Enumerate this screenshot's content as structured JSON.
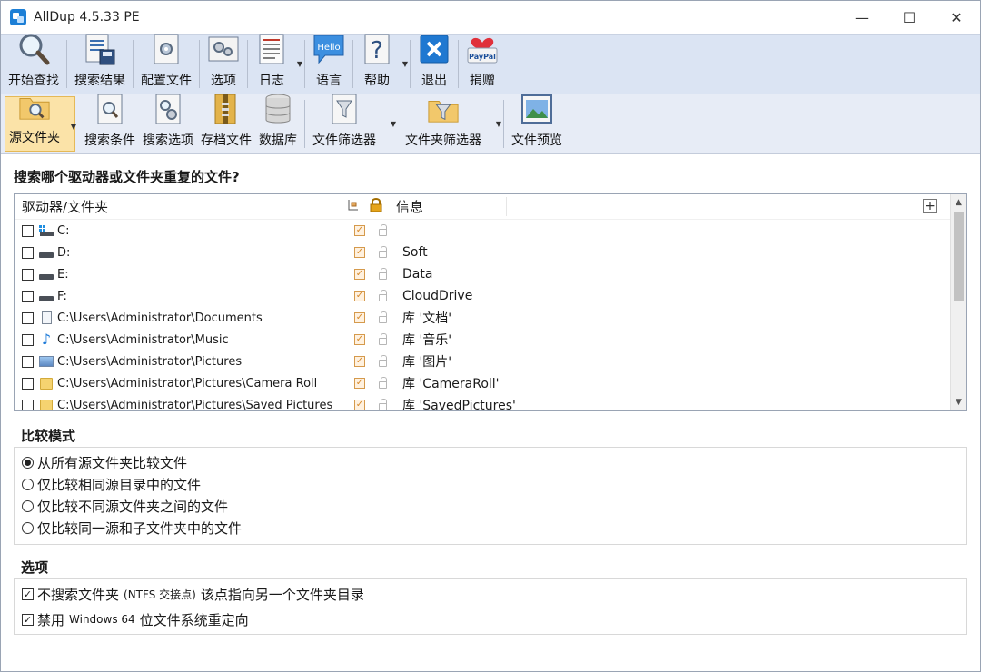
{
  "window": {
    "title": "AllDup 4.5.33 PE",
    "minimize": "—",
    "maximize": "☐",
    "close": "✕"
  },
  "toolbar_primary": [
    {
      "id": "start-search",
      "label": "开始查找",
      "icon": "magnifier-icon"
    },
    {
      "id": "search-results",
      "label": "搜索结果",
      "icon": "results-save-icon"
    },
    {
      "id": "config-file",
      "label": "配置文件",
      "icon": "config-doc-icon"
    },
    {
      "id": "options",
      "label": "选项",
      "icon": "options-gear-icon"
    },
    {
      "id": "log",
      "label": "日志",
      "icon": "log-doc-icon"
    },
    {
      "id": "language",
      "label": "语言",
      "icon": "hello-bubble-icon",
      "icon_text": "Hello"
    },
    {
      "id": "help",
      "label": "帮助",
      "icon": "help-question-icon"
    },
    {
      "id": "exit",
      "label": "退出",
      "icon": "exit-x-icon"
    },
    {
      "id": "donate",
      "label": "捐赠",
      "icon": "paypal-heart-icon",
      "icon_text": "PayPal"
    }
  ],
  "toolbar_secondary": [
    {
      "id": "source-folder",
      "label": "源文件夹",
      "icon": "source-folder-icon"
    },
    {
      "id": "search-criteria",
      "label": "搜索条件",
      "icon": "search-criteria-icon"
    },
    {
      "id": "search-options",
      "label": "搜索选项",
      "icon": "search-options-icon"
    },
    {
      "id": "archive-files",
      "label": "存档文件",
      "icon": "archive-zip-icon"
    },
    {
      "id": "database",
      "label": "数据库",
      "icon": "database-icon"
    },
    {
      "id": "file-filter",
      "label": "文件筛选器",
      "icon": "file-filter-icon"
    },
    {
      "id": "folder-filter",
      "label": "文件夹筛选器",
      "icon": "folder-filter-icon"
    },
    {
      "id": "file-preview",
      "label": "文件预览",
      "icon": "file-preview-icon"
    }
  ],
  "main": {
    "question": "搜索哪个驱动器或文件夹重复的文件?",
    "list": {
      "col_name": "驱动器/文件夹",
      "col_info": "信息",
      "add_column": "+",
      "rows": [
        {
          "path": "C:",
          "info": "",
          "icon": "drive-c-icon"
        },
        {
          "path": "D:",
          "info": "Soft",
          "icon": "drive-icon"
        },
        {
          "path": "E:",
          "info": "Data",
          "icon": "drive-icon"
        },
        {
          "path": "F:",
          "info": "CloudDrive",
          "icon": "drive-icon"
        },
        {
          "path": "C:\\Users\\Administrator\\Documents",
          "info": "库 '文档'",
          "icon": "documents-icon"
        },
        {
          "path": "C:\\Users\\Administrator\\Music",
          "info": "库 '音乐'",
          "icon": "music-note-icon"
        },
        {
          "path": "C:\\Users\\Administrator\\Pictures",
          "info": "库 '图片'",
          "icon": "pictures-icon"
        },
        {
          "path": "C:\\Users\\Administrator\\Pictures\\Camera Roll",
          "info": "库 'CameraRoll'",
          "icon": "folder-icon"
        },
        {
          "path": "C:\\Users\\Administrator\\Pictures\\Saved Pictures",
          "info": "库 'SavedPictures'",
          "icon": "folder-icon"
        }
      ]
    },
    "compare_mode": {
      "title": "比较模式",
      "selected_index": 0,
      "options": [
        "从所有源文件夹比较文件",
        "仅比较相同源目录中的文件",
        "仅比较不同源文件夹之间的文件",
        "仅比较同一源和子文件夹中的文件"
      ]
    },
    "options": {
      "title": "选项",
      "items": [
        {
          "pre": "不搜索文件夹",
          "small": "(NTFS 交接点)",
          "post": "该点指向另一个文件夹目录",
          "checked": true
        },
        {
          "pre": "禁用",
          "small": "Windows 64",
          "post": "位文件系统重定向",
          "checked": true
        }
      ]
    }
  }
}
